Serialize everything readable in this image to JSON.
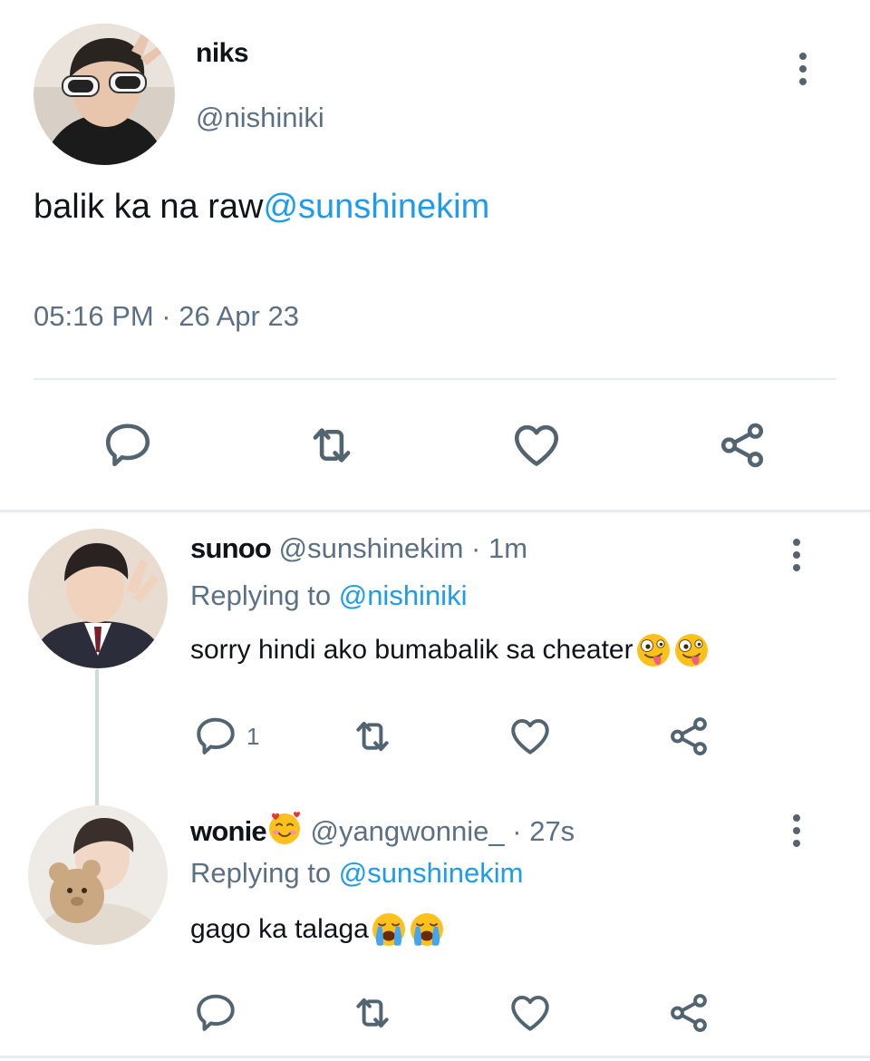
{
  "colors": {
    "link": "#1d9bf0",
    "secondary_text": "#5b7083",
    "primary_text": "#0f1419",
    "divider": "#e6ecf0",
    "icon": "#536471"
  },
  "main_tweet": {
    "name": "niks",
    "handle": "@nishiniki",
    "text": "balik ka na raw",
    "mention": "@sunshinekim",
    "timestamp": "05:16 PM · 26 Apr 23",
    "icons": [
      "reply-icon",
      "retweet-icon",
      "like-icon",
      "share-icon",
      "more-icon"
    ]
  },
  "replies": [
    {
      "name": "sunoo",
      "handle": "@sunshinekim",
      "time_sep": " · ",
      "age": "1m",
      "replying_label": "Replying to ",
      "replying_to": "@nishiniki",
      "text": "sorry hindi ako bumabalik sa cheater",
      "emojis": [
        "zany-face-icon",
        "zany-face-icon"
      ],
      "reply_count": "1"
    },
    {
      "name": "wonie",
      "name_emoji": "smiling-face-with-hearts-icon",
      "handle": "@yangwonnie_",
      "time_sep": " · ",
      "age": "27s",
      "replying_label": "Replying to ",
      "replying_to": "@sunshinekim",
      "text": "gago ka talaga",
      "emojis": [
        "loudly-crying-face-icon",
        "loudly-crying-face-icon"
      ]
    }
  ]
}
